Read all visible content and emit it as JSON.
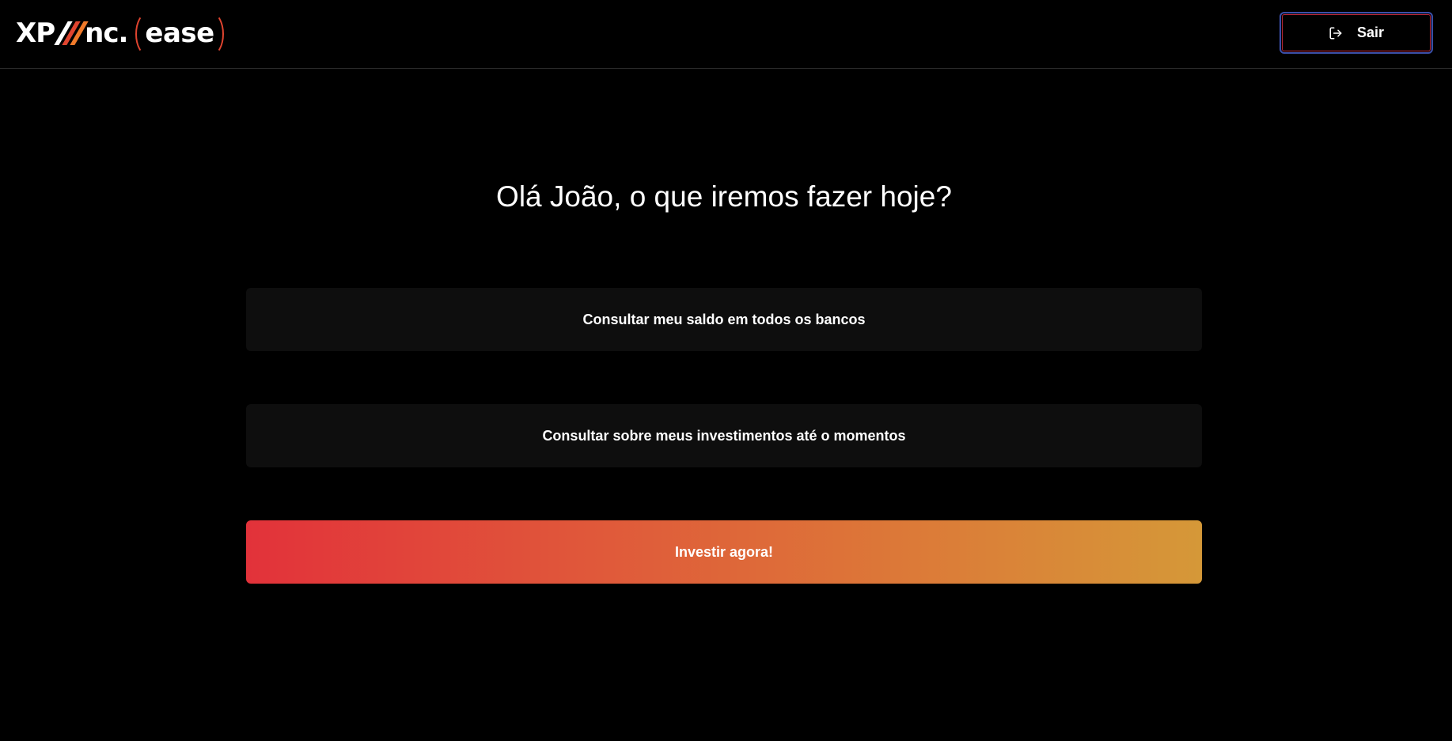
{
  "header": {
    "logo": {
      "brand_text": "XP",
      "brand_suffix": "nc.",
      "product_text": "ease",
      "accent_color": "#e0442f",
      "slash_colors": [
        "#ffffff",
        "#e0442f",
        "#f07a2a"
      ]
    },
    "logout_label": "Sair",
    "logout_icon": "logout-icon"
  },
  "main": {
    "greeting": "Olá João, o que iremos fazer hoje?",
    "options": [
      {
        "label": "Consultar meu saldo em todos os bancos"
      },
      {
        "label": "Consultar sobre meus investimentos até o momentos"
      },
      {
        "label": "Investir agora!"
      }
    ],
    "cta_gradient": [
      "#e2323a",
      "#d59838"
    ]
  },
  "colors": {
    "background": "#000000",
    "card_background": "#0e0e0e",
    "text": "#ffffff",
    "button_border": "#3b4fa8"
  }
}
